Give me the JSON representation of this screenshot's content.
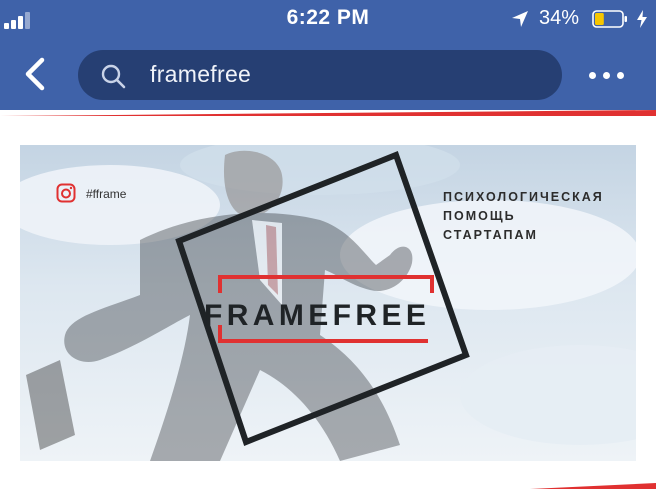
{
  "status_bar": {
    "time": "6:22 PM",
    "battery_percent": "34%",
    "battery_level": 0.34,
    "icons": [
      "signal-icon",
      "location-arrow-icon",
      "battery-icon",
      "charging-bolt-icon"
    ]
  },
  "navbar": {
    "back_icon": "chevron-left-icon",
    "search_icon": "search-icon",
    "search_query": "framefree",
    "more_icon": "more-dots-icon"
  },
  "cover": {
    "hashtag": "#fframe",
    "social_icon": "instagram-icon",
    "subtitle_lines": [
      "ПСИХОЛОГИЧЕСКАЯ",
      "ПОМОЩЬ",
      "СТАРТАПАМ"
    ],
    "brand": "FRAMEFREE"
  },
  "colors": {
    "header_blue": "#3f62a9",
    "search_field": "#263f73",
    "accent_red": "#e03131",
    "battery_yellow": "#f7c600",
    "frame_dark": "#1f2326"
  }
}
